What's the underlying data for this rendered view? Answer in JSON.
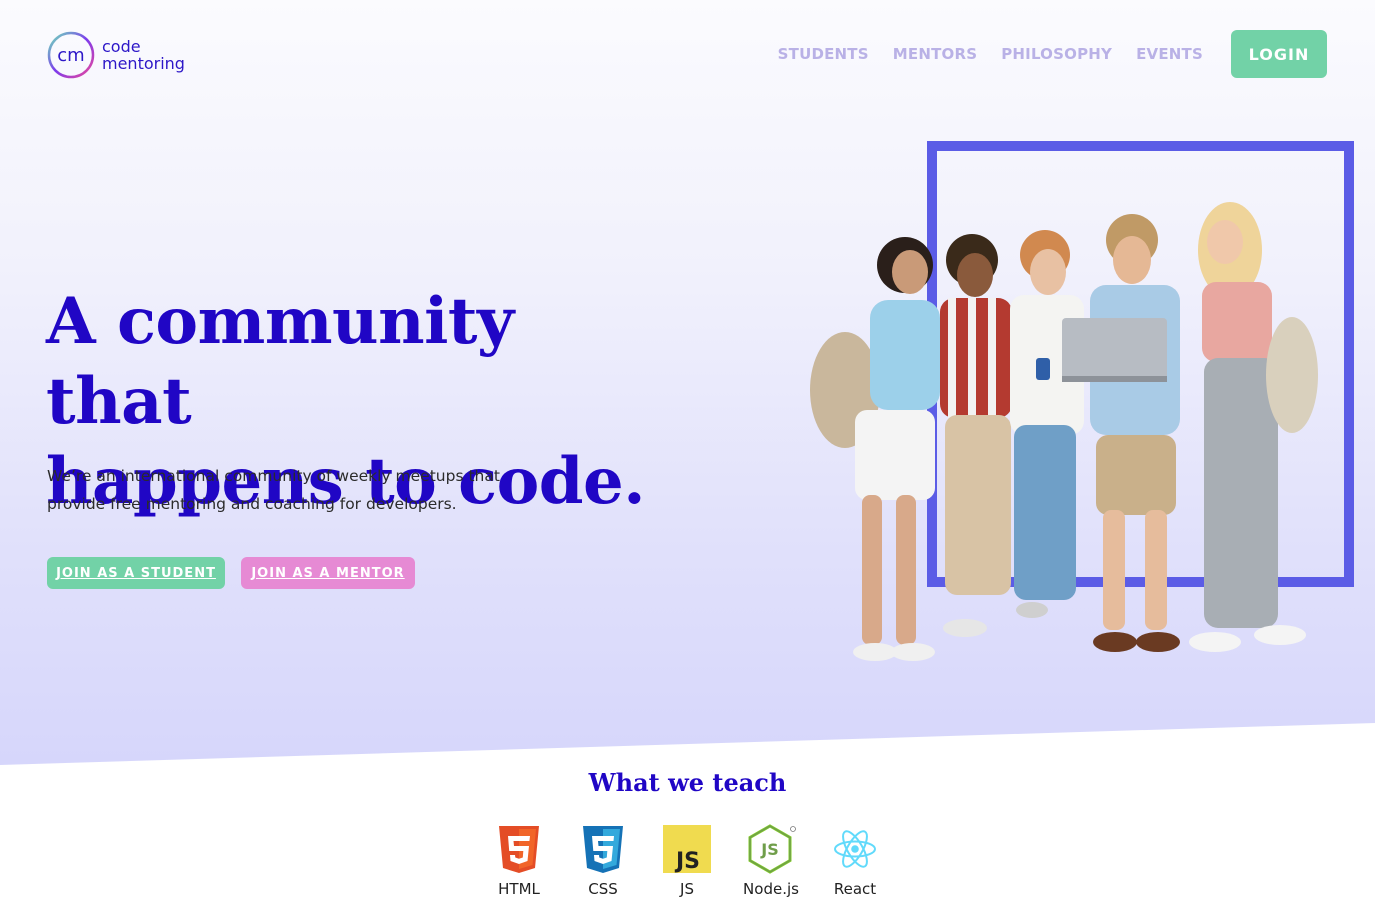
{
  "logo": {
    "mark": "cm",
    "line1": "code",
    "line2": "mentoring"
  },
  "nav": {
    "items": [
      {
        "label": "STUDENTS"
      },
      {
        "label": "MENTORS"
      },
      {
        "label": "PHILOSOPHY"
      },
      {
        "label": "EVENTS"
      }
    ],
    "login_label": "LOGIN"
  },
  "hero": {
    "headline_line1": "A community that",
    "headline_line2": "happens to code.",
    "subtitle": "We’re an international community of weekly meetups that provide free mentoring and coaching for developers.",
    "student_button": "JOIN AS A STUDENT",
    "mentor_button": "JOIN AS A MENTOR",
    "image_alt": "Group of students looking at a laptop"
  },
  "teach": {
    "title": "What we teach",
    "items": [
      {
        "label": "HTML",
        "icon": "html5-icon"
      },
      {
        "label": "CSS",
        "icon": "css3-icon"
      },
      {
        "label": "JS",
        "icon": "js-icon"
      },
      {
        "label": "Node.js",
        "icon": "nodejs-icon"
      },
      {
        "label": "React",
        "icon": "react-icon"
      }
    ]
  },
  "colors": {
    "brand": "#2006c5",
    "green": "#72d2a7",
    "pink": "#e68ad4",
    "frame": "#5b5ce6",
    "nav": "#b9b1e6"
  }
}
